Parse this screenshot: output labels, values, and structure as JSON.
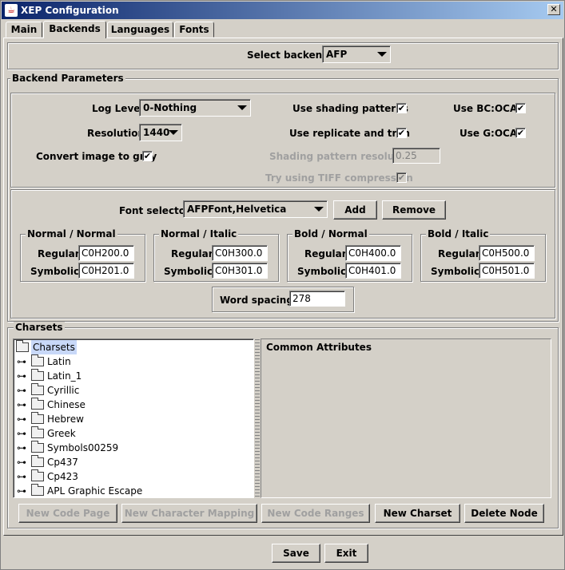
{
  "window": {
    "title": "XEP Configuration",
    "close_glyph": "✕"
  },
  "tabs": [
    {
      "label": "Main"
    },
    {
      "label": "Backends"
    },
    {
      "label": "Languages"
    },
    {
      "label": "Fonts"
    }
  ],
  "select_backend": {
    "label": "Select backend",
    "value": "AFP"
  },
  "backend_params": {
    "title": "Backend Parameters",
    "log_level": {
      "label": "Log Level",
      "value": "0-Nothing"
    },
    "resolution": {
      "label": "Resolution",
      "value": "1440"
    },
    "convert_gray": {
      "label": "Convert image to gray",
      "checked": "✔"
    },
    "use_shading": {
      "label": "Use shading patterns",
      "checked": "✔"
    },
    "use_replicate": {
      "label": "Use replicate and trim",
      "checked": "✔"
    },
    "shading_resolution": {
      "label": "Shading pattern resolution",
      "value": "0.25"
    },
    "tiff": {
      "label": "Try using TIFF compression",
      "checked": "✔"
    },
    "use_bc_oca": {
      "label": "Use BC:OCA",
      "checked": "✔"
    },
    "use_g_oca": {
      "label": "Use G:OCA",
      "checked": "✔"
    }
  },
  "font_selector": {
    "label": "Font selector",
    "value": "AFPFont,Helvetica",
    "add_label": "Add",
    "remove_label": "Remove"
  },
  "font_groups": [
    {
      "title": "Normal / Normal",
      "regular_label": "Regular:",
      "regular": "C0H200.0",
      "symbolic_label": "Symbolic:",
      "symbolic": "C0H201.0"
    },
    {
      "title": "Normal / Italic",
      "regular_label": "Regular:",
      "regular": "C0H300.0",
      "symbolic_label": "Symbolic:",
      "symbolic": "C0H301.0"
    },
    {
      "title": "Bold / Normal",
      "regular_label": "Regular:",
      "regular": "C0H400.0",
      "symbolic_label": "Symbolic:",
      "symbolic": "C0H401.0"
    },
    {
      "title": "Bold / Italic",
      "regular_label": "Regular:",
      "regular": "C0H500.0",
      "symbolic_label": "Symbolic:",
      "symbolic": "C0H501.0"
    }
  ],
  "word_spacing": {
    "label": "Word spacing:",
    "value": "278"
  },
  "charsets": {
    "title": "Charsets",
    "root": "Charsets",
    "items": [
      "Latin",
      "Latin_1",
      "Cyrillic",
      "Chinese",
      "Hebrew",
      "Greek",
      "Symbols00259",
      "Cp437",
      "Cp423",
      "APL Graphic Escape"
    ],
    "common_attributes_label": "Common Attributes",
    "buttons": {
      "new_code_page": "New Code Page",
      "new_char_mapping": "New Character Mapping",
      "new_code_ranges": "New Code Ranges",
      "new_charset": "New Charset",
      "delete_node": "Delete Node"
    }
  },
  "footer": {
    "save_label": "Save",
    "exit_label": "Exit"
  }
}
